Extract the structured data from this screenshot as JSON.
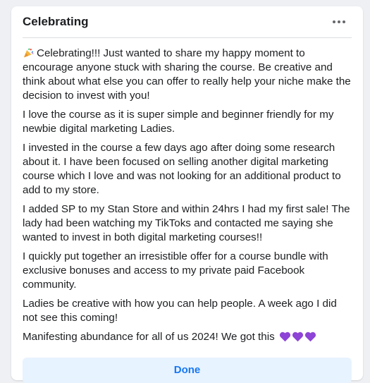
{
  "post": {
    "title": "Celebrating",
    "more_icon": "more-horizontal-icon",
    "intro_emoji": "party-popper-icon",
    "paragraphs": [
      "Celebrating!!!  Just wanted to share my happy moment to encourage anyone stuck with sharing the course. Be creative and think about what else you can offer to really help your niche make the decision to invest with you!",
      "I love the course as it is super simple and beginner friendly for my newbie digital marketing Ladies.",
      "I invested in the course a few days ago after doing some research about it.  I have been focused on selling another digital marketing course which I love and was not looking for an additional product to add to my store.",
      "I added SP to my Stan Store and within 24hrs I had my first sale! The lady had been watching my TikToks and contacted me saying she wanted to invest in both digital marketing courses!!",
      "I quickly put together an irresistible offer for a course bundle with exclusive bonuses and access to my private paid Facebook community.",
      "Ladies be creative with how you can help people.  A week ago I did not see this coming!",
      "Manifesting abundance for all of us 2024! We got this"
    ],
    "hearts": [
      "purple-heart-icon",
      "purple-heart-icon",
      "purple-heart-icon"
    ],
    "done_label": "Done"
  },
  "colors": {
    "accent": "#1877f2",
    "button_bg": "#e7f3ff",
    "heart": "#8e44d6"
  }
}
